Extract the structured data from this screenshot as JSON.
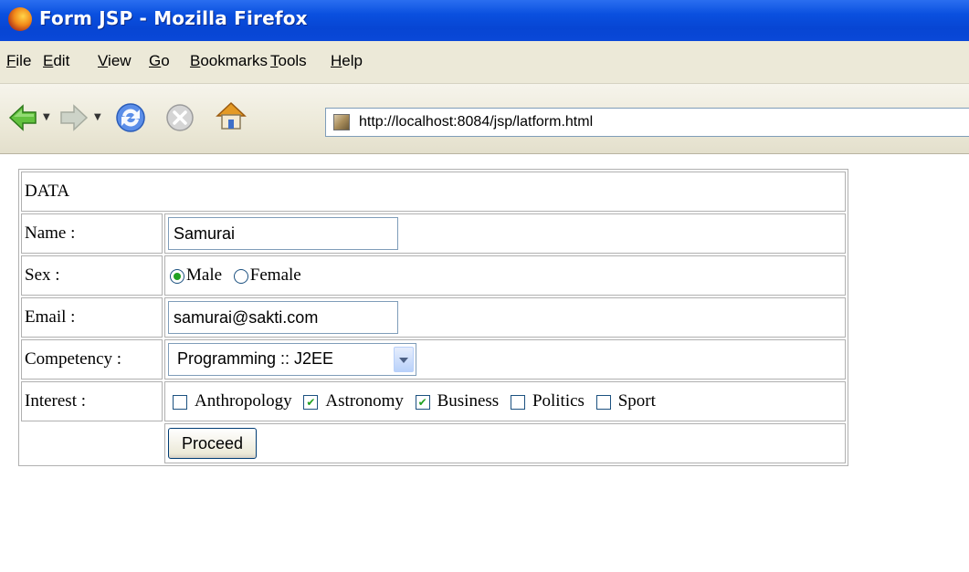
{
  "window": {
    "title": "Form JSP - Mozilla Firefox"
  },
  "menu": [
    "File",
    "Edit",
    "View",
    "Go",
    "Bookmarks",
    "Tools",
    "Help"
  ],
  "navigation": {
    "url": "http://localhost:8084/jsp/latform.html"
  },
  "form": {
    "header": "DATA",
    "name_label": "Name :",
    "name_value": "Samurai",
    "sex_label": "Sex :",
    "sex_options": [
      "Male",
      "Female"
    ],
    "sex_selected": "Male",
    "email_label": "Email :",
    "email_value": "samurai@sakti.com",
    "competency_label": "Competency :",
    "competency_value": "Programming :: J2EE",
    "interest_label": "Interest :",
    "interests": [
      {
        "label": "Anthropology",
        "checked": false
      },
      {
        "label": "Astronomy",
        "checked": true
      },
      {
        "label": "Business",
        "checked": true
      },
      {
        "label": "Politics",
        "checked": false
      },
      {
        "label": "Sport",
        "checked": false
      }
    ],
    "submit_label": "Proceed"
  },
  "colors": {
    "titlebar": "#0a50df",
    "chrome": "#ece9d8",
    "check": "#21a121"
  }
}
